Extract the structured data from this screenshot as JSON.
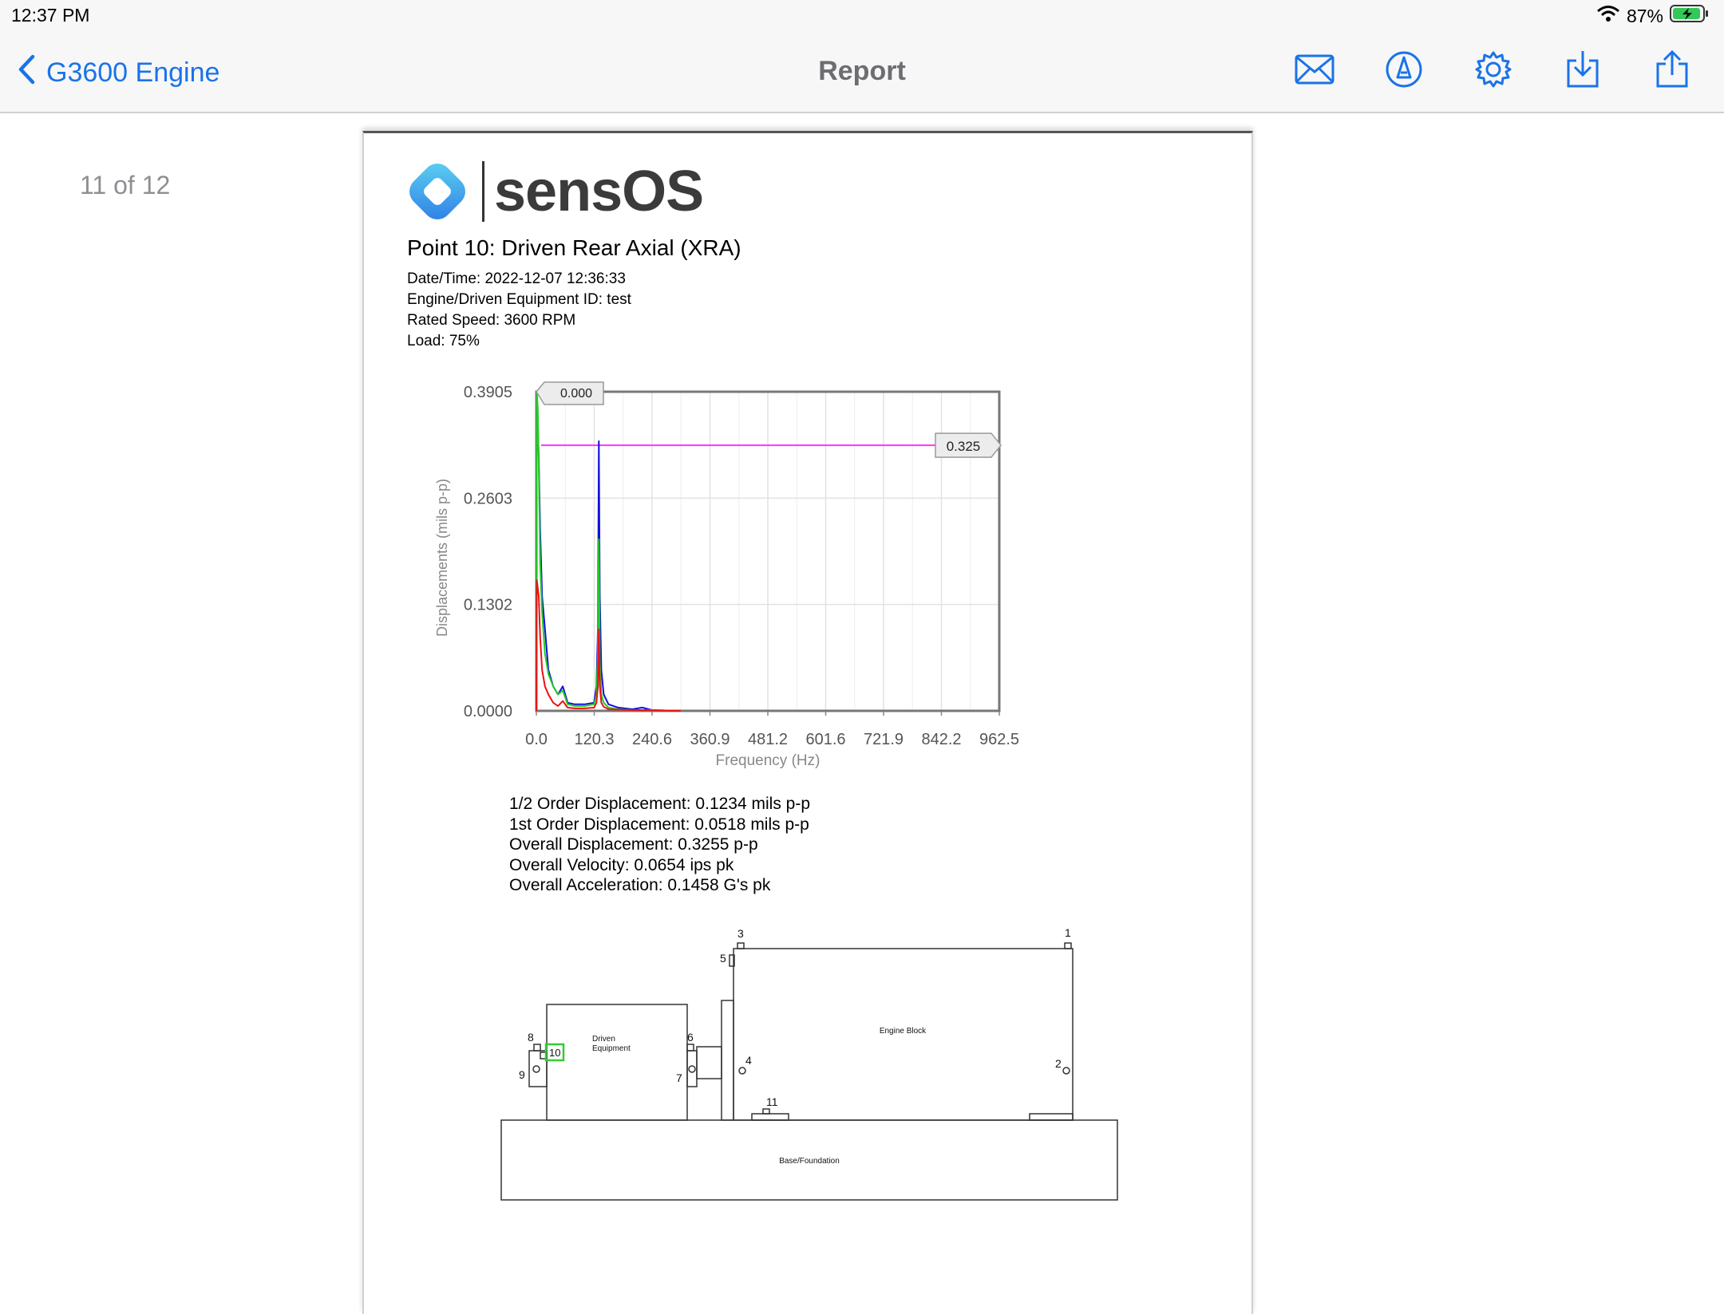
{
  "status": {
    "time": "12:37 PM",
    "battery": "87%"
  },
  "nav": {
    "back_label": "G3600 Engine",
    "title": "Report"
  },
  "page_counter": "11 of 12",
  "logo": {
    "text": "sensOS"
  },
  "report": {
    "point_title": "Point 10: Driven Rear Axial (XRA)",
    "meta": [
      "Date/Time: 2022-12-07 12:36:33",
      "Engine/Driven Equipment ID: test",
      "Rated Speed: 3600 RPM",
      "Load: 75%"
    ],
    "stats": [
      "1/2 Order Displacement: 0.1234 mils p-p",
      "1st Order Displacement: 0.0518 mils p-p",
      "Overall Displacement: 0.3255 p-p",
      "Overall Velocity: 0.0654 ips pk",
      "Overall Acceleration: 0.1458 G's pk"
    ]
  },
  "chart_data": {
    "type": "line",
    "xlabel": "Frequency (Hz)",
    "ylabel": "Displacements (mils p-p)",
    "xlim": [
      0,
      962.5
    ],
    "ylim": [
      0,
      0.3905
    ],
    "x_ticks": [
      "0.0",
      "120.3",
      "240.6",
      "360.9",
      "481.2",
      "601.6",
      "721.9",
      "842.2",
      "962.5"
    ],
    "y_ticks": [
      "0.0000",
      "0.1302",
      "0.2603",
      "0.3905"
    ],
    "cursor_label": "0.000",
    "threshold": {
      "value": 0.325,
      "label": "0.325",
      "color": "#ff33ff"
    },
    "series": [
      {
        "color": "#1010dd",
        "x": [
          0,
          1,
          3,
          5,
          8,
          12,
          18,
          25,
          35,
          45,
          55,
          65,
          80,
          100,
          120,
          125,
          128,
          130,
          132,
          135,
          140,
          150,
          170,
          200,
          220,
          240,
          300
        ],
        "y": [
          0.0,
          0.37,
          0.35,
          0.31,
          0.22,
          0.14,
          0.1,
          0.05,
          0.03,
          0.02,
          0.03,
          0.01,
          0.008,
          0.008,
          0.01,
          0.03,
          0.1,
          0.33,
          0.14,
          0.05,
          0.02,
          0.008,
          0.004,
          0.002,
          0.004,
          0.001,
          0.0
        ]
      },
      {
        "color": "#22cc22",
        "x": [
          0,
          1,
          3,
          5,
          8,
          12,
          18,
          25,
          35,
          45,
          55,
          65,
          80,
          100,
          120,
          125,
          128,
          130,
          132,
          135,
          140,
          150,
          170,
          200,
          240,
          300
        ],
        "y": [
          0.0,
          0.39,
          0.37,
          0.3,
          0.18,
          0.12,
          0.07,
          0.045,
          0.03,
          0.02,
          0.025,
          0.008,
          0.006,
          0.006,
          0.008,
          0.02,
          0.07,
          0.21,
          0.06,
          0.02,
          0.01,
          0.004,
          0.002,
          0.001,
          0.001,
          0.0
        ]
      },
      {
        "color": "#ee1111",
        "x": [
          0,
          1,
          3,
          5,
          8,
          12,
          18,
          25,
          35,
          45,
          55,
          65,
          80,
          100,
          120,
          125,
          128,
          130,
          132,
          135,
          140,
          150,
          200,
          300
        ],
        "y": [
          0.0,
          0.16,
          0.15,
          0.14,
          0.09,
          0.05,
          0.03,
          0.02,
          0.01,
          0.006,
          0.012,
          0.004,
          0.003,
          0.003,
          0.004,
          0.01,
          0.03,
          0.1,
          0.03,
          0.01,
          0.005,
          0.002,
          0.001,
          0.0
        ]
      }
    ]
  },
  "diagram": {
    "labels": {
      "engine": "Engine Block",
      "driven_line1": "Driven",
      "driven_line2": "Equipment",
      "base": "Base/Foundation"
    },
    "points": [
      "1",
      "2",
      "3",
      "4",
      "5",
      "6",
      "7",
      "8",
      "9",
      "10",
      "11"
    ],
    "highlight_point": "10",
    "highlight_color": "#33cc33"
  }
}
